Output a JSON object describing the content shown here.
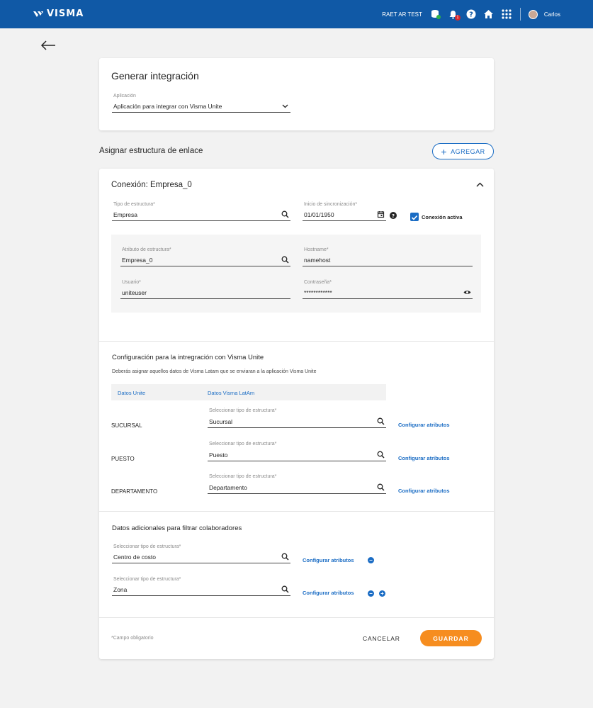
{
  "topbar": {
    "brand": "VISMA",
    "tenant": "RAET AR TEST",
    "notification_count": "1",
    "user_name": "Carlos",
    "icons": [
      "database-check-icon",
      "bell-icon",
      "help-icon",
      "home-icon",
      "apps-grid-icon"
    ],
    "colors": {
      "bar": "#1059a6",
      "badge": "#d7262b"
    }
  },
  "card1": {
    "title": "Generar integración",
    "app_label": "Aplicación",
    "app_value": "Aplicación para integrar con Visma Unite"
  },
  "section": {
    "title": "Asignar estructura de enlace",
    "add_label": "AGREGAR"
  },
  "connection": {
    "title": "Conexión: Empresa_0",
    "tipo_label": "Tipo de estructura*",
    "tipo_value": "Empresa",
    "sync_label": "Inicio de sincronización*",
    "sync_value": "01/01/1950",
    "active_label": "Conexión activa",
    "attr_label": "Atributo de estructura*",
    "attr_value": "Empresa_0",
    "host_label": "Hostname*",
    "host_value": "namehost",
    "user_label": "Usuario*",
    "user_value": "uniteuser",
    "pass_label": "Contraseña*",
    "pass_value": "************"
  },
  "config": {
    "title": "Configuración para la intregración con Visma Unite",
    "subtitle": "Deberás asignar aquellos datos de Visma Latam que se enviaran a la aplicación Visma Unite",
    "col1": "Datos Unite",
    "col2": "Datos Visma LatAm",
    "rows": [
      {
        "label": "SUCURSAL",
        "field_label": "Seleccionar tipo de estructura*",
        "value": "Sucursal",
        "link": "Configurar atributos"
      },
      {
        "label": "PUESTO",
        "field_label": "Seleccionar tipo de estructura*",
        "value": "Puesto",
        "link": "Configurar atributos"
      },
      {
        "label": "DEPARTAMENTO",
        "field_label": "Seleccionar tipo de estructura*",
        "value": "Departamento",
        "link": "Configurar atributos"
      }
    ]
  },
  "extra": {
    "title": "Datos adicionales para filtrar colaboradores",
    "rows": [
      {
        "field_label": "Seleccionar tipo de estructura*",
        "value": "Centro de costo",
        "link": "Configurar atributos"
      },
      {
        "field_label": "Seleccionar tipo de estructura*",
        "value": "Zona",
        "link": "Configurar atributos"
      }
    ]
  },
  "footer": {
    "required_note": "*Campo obligatorio",
    "cancel_label": "CANCELAR",
    "save_label": "GUARDAR",
    "save_color": "#f68d1f"
  }
}
